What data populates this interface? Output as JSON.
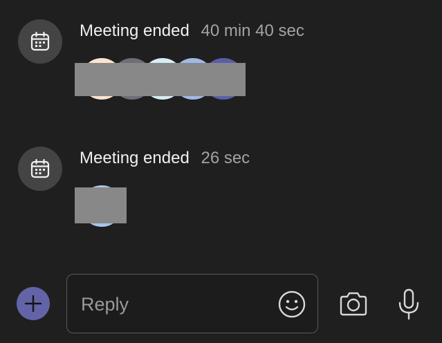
{
  "events": [
    {
      "icon": "calendar-icon",
      "title": "Meeting ended",
      "duration": "40 min 40 sec",
      "avatars": [
        "#fde3cf",
        "#6e6e78",
        "#d7ecf3",
        "#9fb8e6",
        "#5b5ea8"
      ]
    },
    {
      "icon": "calendar-icon",
      "title": "Meeting ended",
      "duration": "26 sec",
      "avatars": [
        "#a9c5eb"
      ]
    }
  ],
  "composer": {
    "add_icon": "plus-icon",
    "placeholder": "Reply",
    "emoji_icon": "smiley-icon",
    "camera_icon": "camera-icon",
    "mic_icon": "microphone-icon"
  },
  "colors": {
    "background": "#1f1f1f",
    "accent": "#6264a7",
    "icon_circle": "#444444",
    "redaction": "#888888"
  }
}
